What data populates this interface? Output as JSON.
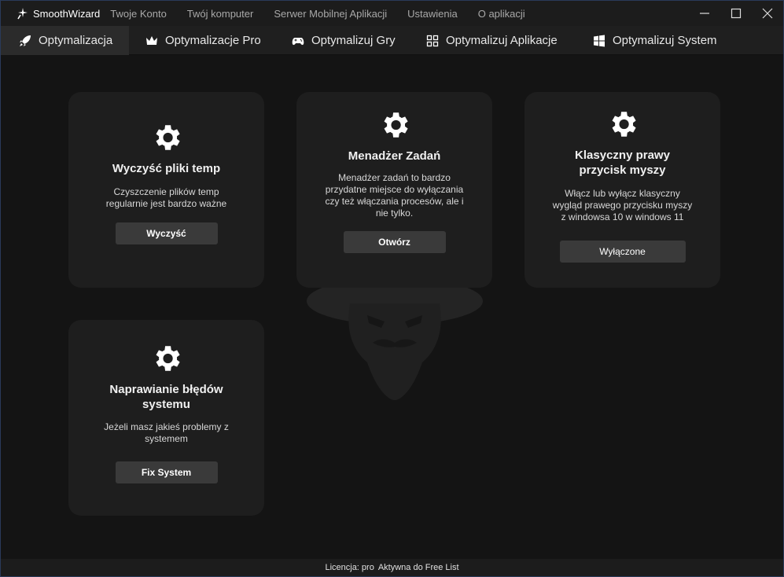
{
  "app": {
    "name": "SmoothWizard"
  },
  "menu": [
    "Twoje Konto",
    "Twój komputer",
    "Serwer Mobilnej Aplikacji",
    "Ustawienia",
    "O aplikacji"
  ],
  "tabs": [
    {
      "label": "Optymalizacja",
      "icon": "rocket-icon"
    },
    {
      "label": "Optymalizacje Pro",
      "icon": "crown-icon"
    },
    {
      "label": "Optymalizuj Gry",
      "icon": "gamepad-icon"
    },
    {
      "label": "Optymalizuj Aplikacje",
      "icon": "apps-grid-icon"
    },
    {
      "label": "Optymalizuj System",
      "icon": "windows-logo-icon"
    }
  ],
  "cards": {
    "temp": {
      "title": "Wyczyść pliki temp",
      "desc": [
        "Czyszczenie plików temp",
        "regularnie jest bardzo ważne"
      ],
      "button": "Wyczyść"
    },
    "taskmgr": {
      "title": "Menadżer Zadań",
      "desc": [
        "Menadżer zadań to bardzo",
        "przydatne miejsce do wyłączania",
        "czy też włączania procesów, ale i",
        "nie tylko."
      ],
      "button": "Otwórz"
    },
    "rightclick": {
      "title": [
        "Klasyczny prawy",
        "przycisk myszy"
      ],
      "desc": [
        "Włącz lub wyłącz klasyczny",
        "wygląd prawego przycisku myszy",
        "z windowsa 10 w windows 11"
      ],
      "button": "Wyłączone"
    },
    "fix": {
      "title": [
        "Naprawianie błędów",
        "systemu"
      ],
      "desc": [
        "Jeżeli masz jakieś problemy z",
        "systemem"
      ],
      "button": "Fix System"
    }
  },
  "footer": {
    "license_label": "Licencja: pro",
    "license_value": "Aktywna do Free List"
  },
  "colors": {
    "background": "#141414",
    "card": "#1e1e1e",
    "button": "#3a3a3a",
    "active_tab": "#2b2b2b"
  }
}
